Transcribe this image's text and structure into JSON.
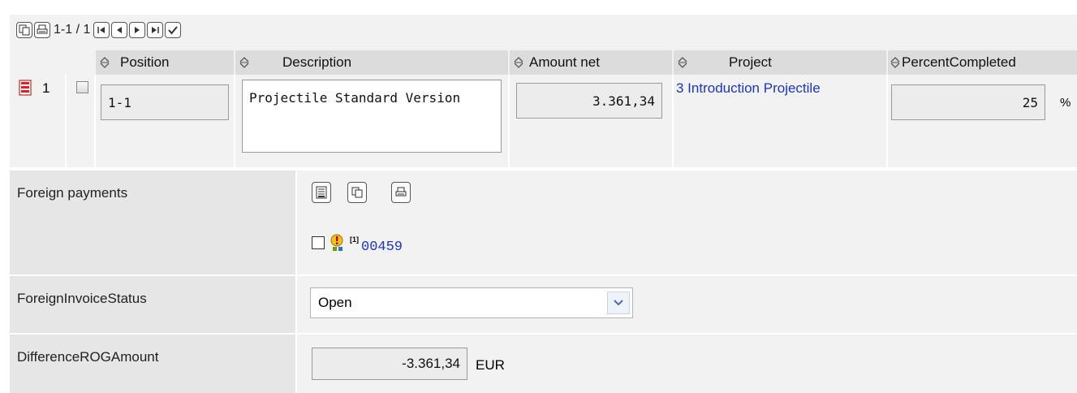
{
  "toolbar": {
    "pager_text": "1-1 / 1",
    "icons": [
      "copy-icon",
      "print-icon",
      "first-page-icon",
      "prev-page-icon",
      "next-page-icon",
      "last-page-icon",
      "confirm-icon"
    ]
  },
  "grid": {
    "headers": {
      "position": "Position",
      "description": "Description",
      "amount_net": "Amount net",
      "project": "Project",
      "percent_completed": "PercentCompleted"
    },
    "row": {
      "index": "1",
      "position": "1-1",
      "description": "Projectile Standard Version",
      "amount_net": "3.361,34",
      "project": "3 Introduction Projectile",
      "percent_completed": "25",
      "percent_unit": "%"
    }
  },
  "form": {
    "foreign_payments": {
      "label": "Foreign payments",
      "item_marker": "[1]",
      "item_link": "00459"
    },
    "foreign_invoice_status": {
      "label": "ForeignInvoiceStatus",
      "selected": "Open"
    },
    "difference_rog_amount": {
      "label": "DifferenceROGAmount",
      "value": "-3.361,34",
      "currency": "EUR"
    }
  },
  "colors": {
    "link": "#1a35c8",
    "header_bg": "#dcdcdc",
    "panel_bg": "#f2f2f2",
    "label_bg": "#e6e6e6"
  }
}
